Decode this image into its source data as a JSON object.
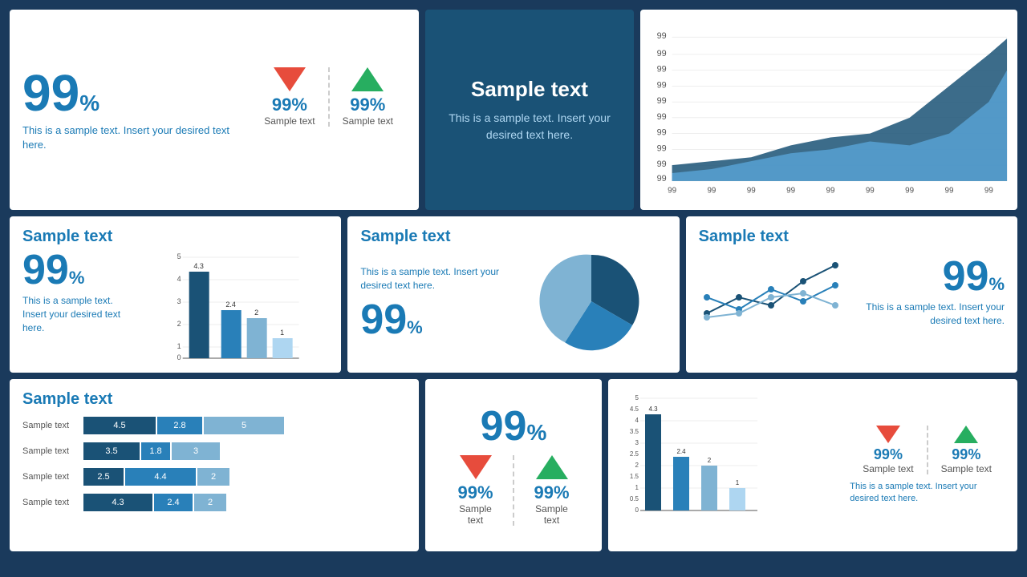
{
  "colors": {
    "dark_blue": "#1a5276",
    "medium_blue": "#1a7ab5",
    "light_blue": "#7fb3d3",
    "red": "#e74c3c",
    "green": "#27ae60",
    "white": "#ffffff"
  },
  "row1": {
    "card1": {
      "big_number": "99",
      "big_percent": "%",
      "description": "This is a sample text. Insert your desired text here.",
      "arrow1": {
        "direction": "down",
        "percent": "99%",
        "label": "Sample text"
      },
      "arrow2": {
        "direction": "up",
        "percent": "99%",
        "label": "Sample text"
      }
    },
    "card2": {
      "title": "Sample text",
      "description": "This is a sample text. Insert your desired text here."
    },
    "card3": {
      "y_labels": [
        "99",
        "99",
        "99",
        "99",
        "99",
        "99",
        "99",
        "99",
        "99",
        "99"
      ],
      "x_labels": [
        "99",
        "99",
        "99",
        "99",
        "99",
        "99",
        "99",
        "99",
        "99"
      ]
    }
  },
  "row2": {
    "card1": {
      "title": "Sample text",
      "big_number": "99",
      "big_percent": "%",
      "description": "This is a sample text. Insert your desired text here.",
      "chart": {
        "bars": [
          {
            "label": "4.3",
            "value": 4.3
          },
          {
            "label": "2.4",
            "value": 2.4
          },
          {
            "label": "2",
            "value": 2.0
          },
          {
            "label": "1",
            "value": 1.0
          }
        ],
        "max": 5,
        "y_ticks": [
          0,
          1,
          2,
          3,
          4,
          5
        ]
      }
    },
    "card2": {
      "title": "Sample text",
      "description": "This is a sample text. Insert your desired text here.",
      "big_number": "99",
      "big_percent": "%",
      "pie_segments": [
        {
          "color": "#1a5276",
          "pct": 40
        },
        {
          "color": "#2980b9",
          "pct": 25
        },
        {
          "color": "#7fb3d3",
          "pct": 35
        }
      ]
    },
    "card3": {
      "title": "Sample text",
      "big_number": "99",
      "big_percent": "%",
      "description": "This is a sample text. Insert your desired text here."
    }
  },
  "row3": {
    "card1": {
      "title": "Sample text",
      "bars": [
        {
          "label": "Sample text",
          "seg1": 4.5,
          "seg2": 2.8,
          "seg3": 5
        },
        {
          "label": "Sample text",
          "seg1": 3.5,
          "seg2": 1.8,
          "seg3": 3
        },
        {
          "label": "Sample text",
          "seg1": 2.5,
          "seg2": 4.4,
          "seg3": 2
        },
        {
          "label": "Sample text",
          "seg1": 4.3,
          "seg2": 2.4,
          "seg3": 2
        }
      ]
    },
    "card2": {
      "big_number": "99",
      "big_percent": "%",
      "arrow1": {
        "direction": "down",
        "percent": "99%",
        "label": "Sample text"
      },
      "arrow2": {
        "direction": "up",
        "percent": "99%",
        "label": "Sample text"
      }
    },
    "card3": {
      "chart": {
        "bars": [
          {
            "label": "4.3",
            "value": 4.3
          },
          {
            "label": "2.4",
            "value": 2.4
          },
          {
            "label": "2",
            "value": 2.0
          },
          {
            "label": "1",
            "value": 1.0
          }
        ],
        "max": 5,
        "y_ticks": [
          0,
          0.5,
          1,
          1.5,
          2,
          2.5,
          3,
          3.5,
          4,
          4.5,
          5
        ]
      },
      "arrow1": {
        "direction": "down",
        "percent": "99%",
        "label": "Sample text"
      },
      "arrow2": {
        "direction": "up",
        "percent": "99%",
        "label": "Sample text"
      },
      "description": "This is a sample text. Insert your desired text here."
    }
  }
}
